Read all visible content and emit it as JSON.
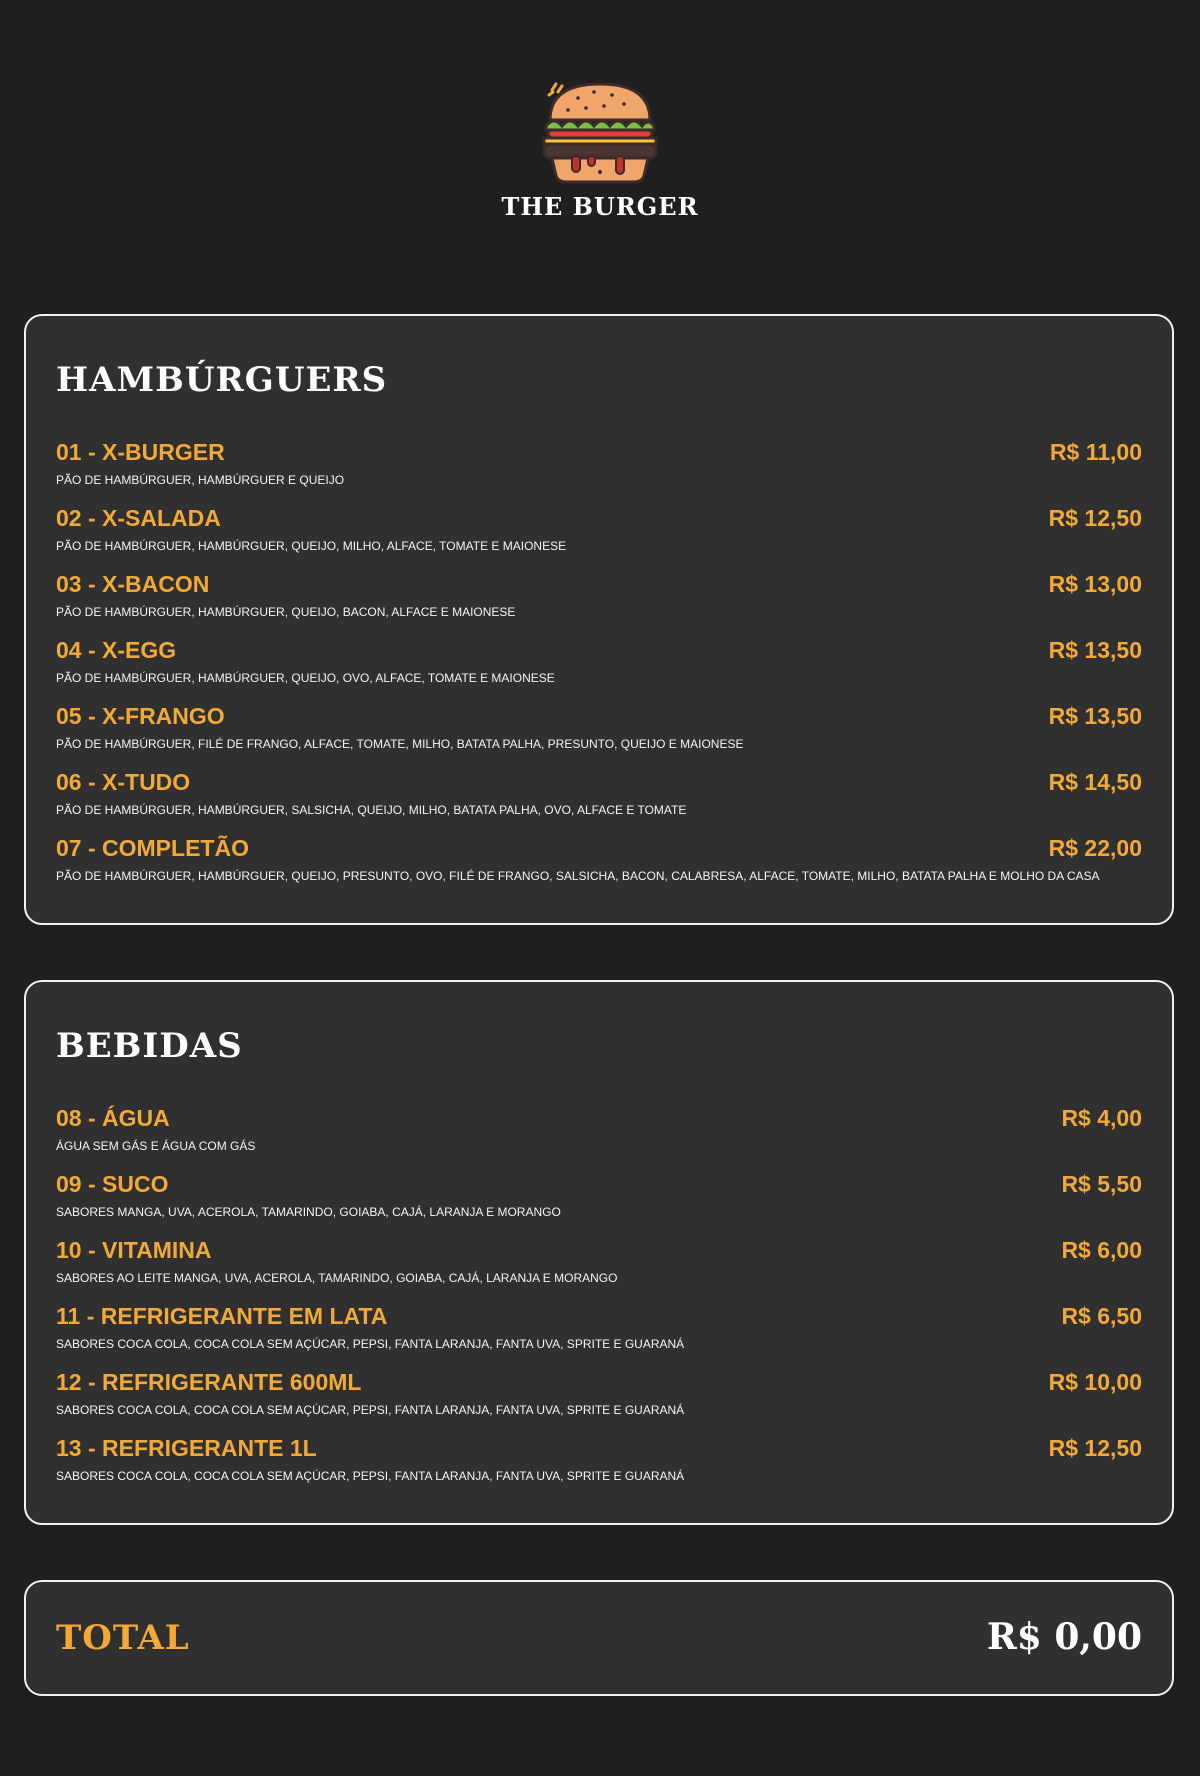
{
  "brand": {
    "name": "THE BURGER",
    "logo_icon": "burger-icon"
  },
  "colors": {
    "background": "#1f1f1f",
    "card": "#303030",
    "accent": "#f3a936",
    "text": "#ffffff"
  },
  "burgers": {
    "title": "HAMBÚRGUERS",
    "items": [
      {
        "name": "01 - X-BURGER",
        "price": "R$ 11,00",
        "description": "PÃO DE HAMBÚRGUER, HAMBÚRGUER E QUEIJO"
      },
      {
        "name": "02 - X-SALADA",
        "price": "R$ 12,50",
        "description": "PÃO DE HAMBÚRGUER, HAMBÚRGUER, QUEIJO, MILHO, ALFACE, TOMATE E MAIONESE"
      },
      {
        "name": "03 - X-BACON",
        "price": "R$ 13,00",
        "description": "PÃO DE HAMBÚRGUER, HAMBÚRGUER, QUEIJO, BACON, ALFACE E MAIONESE"
      },
      {
        "name": "04 - X-EGG",
        "price": "R$ 13,50",
        "description": "PÃO DE HAMBÚRGUER, HAMBÚRGUER, QUEIJO, OVO, ALFACE, TOMATE E MAIONESE"
      },
      {
        "name": "05 - X-FRANGO",
        "price": "R$ 13,50",
        "description": "PÃO DE HAMBÚRGUER, FILÉ DE FRANGO, ALFACE, TOMATE, MILHO, BATATA PALHA, PRESUNTO, QUEIJO E MAIONESE"
      },
      {
        "name": "06 - X-TUDO",
        "price": "R$ 14,50",
        "description": "PÃO DE HAMBÚRGUER, HAMBÚRGUER, SALSICHA, QUEIJO, MILHO, BATATA PALHA, OVO, ALFACE E TOMATE"
      },
      {
        "name": "07 - COMPLETÃO",
        "price": "R$ 22,00",
        "description": "PÃO DE HAMBÚRGUER, HAMBÚRGUER, QUEIJO, PRESUNTO, OVO, FILÉ DE FRANGO, SALSICHA, BACON, CALABRESA, ALFACE, TOMATE, MILHO, BATATA PALHA E MOLHO DA CASA"
      }
    ]
  },
  "drinks": {
    "title": "BEBIDAS",
    "items": [
      {
        "name": "08 - ÁGUA",
        "price": "R$ 4,00",
        "description": "ÁGUA SEM GÁS E ÁGUA COM GÁS"
      },
      {
        "name": "09 - SUCO",
        "price": "R$ 5,50",
        "description": "SABORES MANGA, UVA, ACEROLA, TAMARINDO, GOIABA, CAJÁ, LARANJA E MORANGO"
      },
      {
        "name": "10 - VITAMINA",
        "price": "R$ 6,00",
        "description": "SABORES AO LEITE MANGA, UVA, ACEROLA, TAMARINDO, GOIABA, CAJÁ, LARANJA E MORANGO"
      },
      {
        "name": "11 - REFRIGERANTE EM LATA",
        "price": "R$ 6,50",
        "description": "SABORES COCA COLA, COCA COLA SEM AÇÚCAR, PEPSI, FANTA LARANJA, FANTA UVA, SPRITE E GUARANÁ"
      },
      {
        "name": "12 - REFRIGERANTE 600ML",
        "price": "R$ 10,00",
        "description": "SABORES COCA COLA, COCA COLA SEM AÇÚCAR, PEPSI, FANTA LARANJA, FANTA UVA, SPRITE E GUARANÁ"
      },
      {
        "name": "13 - REFRIGERANTE 1L",
        "price": "R$ 12,50",
        "description": "SABORES COCA COLA, COCA COLA SEM AÇÚCAR, PEPSI, FANTA LARANJA, FANTA UVA, SPRITE E GUARANÁ"
      }
    ]
  },
  "total": {
    "label": "TOTAL",
    "value": "R$ 0,00"
  }
}
